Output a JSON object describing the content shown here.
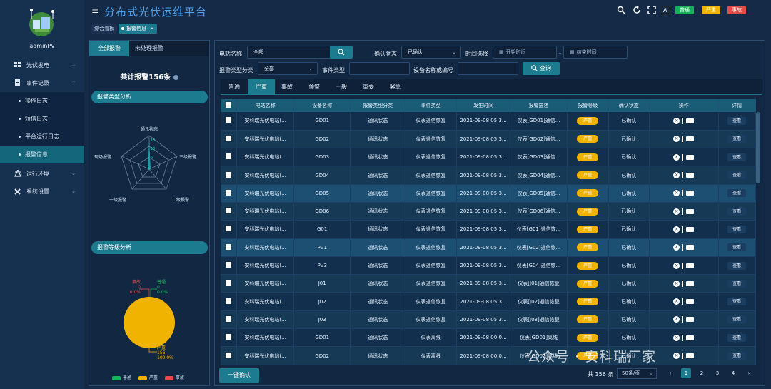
{
  "app": {
    "title": "分布式光伏运维平台",
    "username": "adminPV"
  },
  "header_badges": [
    {
      "label": "普通",
      "color": "#16b35a"
    },
    {
      "label": "严重",
      "color": "#f0b400"
    },
    {
      "label": "事故",
      "color": "#e84a4a"
    }
  ],
  "page_tabs": [
    {
      "label": "综合看板"
    },
    {
      "label": "报警信息",
      "close": "×"
    }
  ],
  "sidebar": {
    "menu": [
      {
        "label": "光伏发电",
        "icon": "grid-icon"
      },
      {
        "label": "事件记录",
        "icon": "record-icon"
      },
      {
        "label": "运行环境",
        "icon": "tower-icon"
      },
      {
        "label": "系统设置",
        "icon": "tools-icon"
      }
    ],
    "submenu": [
      {
        "label": "操作日志"
      },
      {
        "label": "短信日志"
      },
      {
        "label": "平台运行日志"
      },
      {
        "label": "报警信息"
      }
    ]
  },
  "left_panel": {
    "tabs": [
      {
        "label": "全部报警"
      },
      {
        "label": "未处理报警"
      }
    ],
    "total": "共计报警156条",
    "radar_title": "报警类型分析",
    "radar_labels": [
      "通讯状态",
      "三级报警",
      "二级报警",
      "一级报警",
      "现场报警"
    ],
    "radar_ticks": [
      "15",
      "10",
      "5"
    ],
    "pie_title": "报警等级分析",
    "pie_labels": {
      "accident_name": "事故",
      "accident_count": "0",
      "accident_pct": "0.0%",
      "normal_name": "普通",
      "normal_count": "0",
      "normal_pct": "0.0%",
      "severe_name": "严重",
      "severe_count": "156",
      "severe_pct": "100.0%"
    },
    "legend": [
      {
        "label": "普通",
        "color": "#16b35a"
      },
      {
        "label": "严重",
        "color": "#f0b400"
      },
      {
        "label": "事故",
        "color": "#e84a4a"
      }
    ]
  },
  "filters": {
    "station_label": "电站名称",
    "station_value": "全部",
    "confirm_label": "确认状态",
    "confirm_value": "已确认",
    "time_label": "时间选择",
    "start_placeholder": "开始时间",
    "end_placeholder": "结束时间",
    "time_sep": "-",
    "type_label": "报警类型分类",
    "type_value": "全部",
    "event_label": "事件类型",
    "device_label": "设备名称或编号",
    "query_label": "查询"
  },
  "level_tabs": [
    {
      "label": "普通"
    },
    {
      "label": "严重"
    },
    {
      "label": "事故"
    },
    {
      "label": "预警"
    },
    {
      "label": "一般"
    },
    {
      "label": "重要"
    },
    {
      "label": "紧急"
    }
  ],
  "table": {
    "columns": [
      "电站名称",
      "设备名称",
      "报警类型分类",
      "事件类型",
      "发生时间",
      "报警描述",
      "报警等级",
      "确认状态",
      "操作",
      "详情"
    ],
    "rows": [
      {
        "station": "安科瑞光伏电站(...",
        "device": "GD01",
        "category": "通讯状态",
        "event": "仪表通信恢复",
        "time": "2021-09-08 05:3...",
        "desc": "仪表[GD01]通信...",
        "level": "严重",
        "status": "已确认",
        "detail": "查看"
      },
      {
        "station": "安科瑞光伏电站(...",
        "device": "GD02",
        "category": "通讯状态",
        "event": "仪表通信恢复",
        "time": "2021-09-08 05:3...",
        "desc": "仪表[GD02]通信...",
        "level": "严重",
        "status": "已确认",
        "detail": "查看"
      },
      {
        "station": "安科瑞光伏电站(...",
        "device": "GD03",
        "category": "通讯状态",
        "event": "仪表通信恢复",
        "time": "2021-09-08 05:3...",
        "desc": "仪表[GD03]通信...",
        "level": "严重",
        "status": "已确认",
        "detail": "查看"
      },
      {
        "station": "安科瑞光伏电站(...",
        "device": "GD04",
        "category": "通讯状态",
        "event": "仪表通信恢复",
        "time": "2021-09-08 05:3...",
        "desc": "仪表[GD04]通信...",
        "level": "严重",
        "status": "已确认",
        "detail": "查看"
      },
      {
        "station": "安科瑞光伏电站(...",
        "device": "GD05",
        "category": "通讯状态",
        "event": "仪表通信恢复",
        "time": "2021-09-08 05:3...",
        "desc": "仪表[GD05]通信...",
        "level": "严重",
        "status": "已确认",
        "detail": "查看"
      },
      {
        "station": "安科瑞光伏电站(...",
        "device": "GD06",
        "category": "通讯状态",
        "event": "仪表通信恢复",
        "time": "2021-09-08 05:3...",
        "desc": "仪表[GD06]通信...",
        "level": "严重",
        "status": "已确认",
        "detail": "查看"
      },
      {
        "station": "安科瑞光伏电站(...",
        "device": "G01",
        "category": "通讯状态",
        "event": "仪表通信恢复",
        "time": "2021-09-08 05:3...",
        "desc": "仪表[G01]通信恢...",
        "level": "严重",
        "status": "已确认",
        "detail": "查看"
      },
      {
        "station": "安科瑞光伏电站(...",
        "device": "PV1",
        "category": "通讯状态",
        "event": "仪表通信恢复",
        "time": "2021-09-08 05:3...",
        "desc": "仪表[G02]通信恢...",
        "level": "严重",
        "status": "已确认",
        "detail": "查看"
      },
      {
        "station": "安科瑞光伏电站(...",
        "device": "PV3",
        "category": "通讯状态",
        "event": "仪表通信恢复",
        "time": "2021-09-08 05:3...",
        "desc": "仪表[G04]通信恢...",
        "level": "严重",
        "status": "已确认",
        "detail": "查看"
      },
      {
        "station": "安科瑞光伏电站(...",
        "device": "J01",
        "category": "通讯状态",
        "event": "仪表通信恢复",
        "time": "2021-09-08 05:3...",
        "desc": "仪表[J01]通信恢复",
        "level": "严重",
        "status": "已确认",
        "detail": "查看"
      },
      {
        "station": "安科瑞光伏电站(...",
        "device": "J02",
        "category": "通讯状态",
        "event": "仪表通信恢复",
        "time": "2021-09-08 05:3...",
        "desc": "仪表[J02]通信恢复",
        "level": "严重",
        "status": "已确认",
        "detail": "查看"
      },
      {
        "station": "安科瑞光伏电站(...",
        "device": "J03",
        "category": "通讯状态",
        "event": "仪表通信恢复",
        "time": "2021-09-08 05:3...",
        "desc": "仪表[J03]通信恢复",
        "level": "严重",
        "status": "已确认",
        "detail": "查看"
      },
      {
        "station": "安科瑞光伏电站(...",
        "device": "GD01",
        "category": "通讯状态",
        "event": "仪表离线",
        "time": "2021-09-08 00:0...",
        "desc": "仪表[GD01]离线",
        "level": "严重",
        "status": "已确认",
        "detail": "查看"
      },
      {
        "station": "安科瑞光伏电站(...",
        "device": "GD02",
        "category": "通讯状态",
        "event": "仪表离线",
        "time": "2021-09-08 00:0...",
        "desc": "仪表[GD02]离线",
        "level": "严重",
        "status": "已确认",
        "detail": "查看"
      }
    ]
  },
  "footer": {
    "confirm_all": "一键确认",
    "total": "共 156 条",
    "page_size": "50条/页",
    "prev": "‹",
    "next": "›",
    "pages": [
      "1",
      "2",
      "3",
      "4"
    ]
  },
  "watermark": "公众号 · 安科瑞厂家"
}
